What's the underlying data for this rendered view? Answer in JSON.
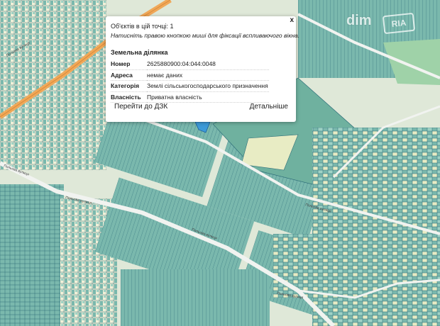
{
  "map": {
    "colors": {
      "background": "#dfe8d8",
      "parcel_teal": "#7ab8ad",
      "parcel_teal_dark": "#5f9f96",
      "parcel_border": "#2f6f7a",
      "field_light": "#e8ecc4",
      "field_pale": "#f2f0d8",
      "green_area": "#7cc4a0",
      "road": "#f1f3f0",
      "highway": "#f0a858",
      "selected_parcel": "#3d9ad8"
    },
    "road_labels": [
      "Польова вулиця",
      "Польова вулиця",
      "Польова вулиця",
      "Польова вулиця",
      "Польова вулиця",
      "Польова вулиця"
    ]
  },
  "popup": {
    "count_text": "Об'єктів в цій точці: 1",
    "hint_text": "Натисніть правою кнопкою миші для фіксації вспливаючого вікна.",
    "close_label": "x",
    "section_title": "Земельна ділянка",
    "rows": [
      {
        "key": "Номер",
        "value": "2625880900:04:044:0048"
      },
      {
        "key": "Адреса",
        "value": "немає даних"
      },
      {
        "key": "Категорія",
        "value": "Землі сільськогосподарського призначення"
      },
      {
        "key": "Власність",
        "value": "Приватна власність"
      }
    ],
    "btn_dzk": "Перейти до ДЗК",
    "btn_details": "Детальніше"
  },
  "watermark": {
    "dim": "dim",
    "ria": "RIA"
  }
}
